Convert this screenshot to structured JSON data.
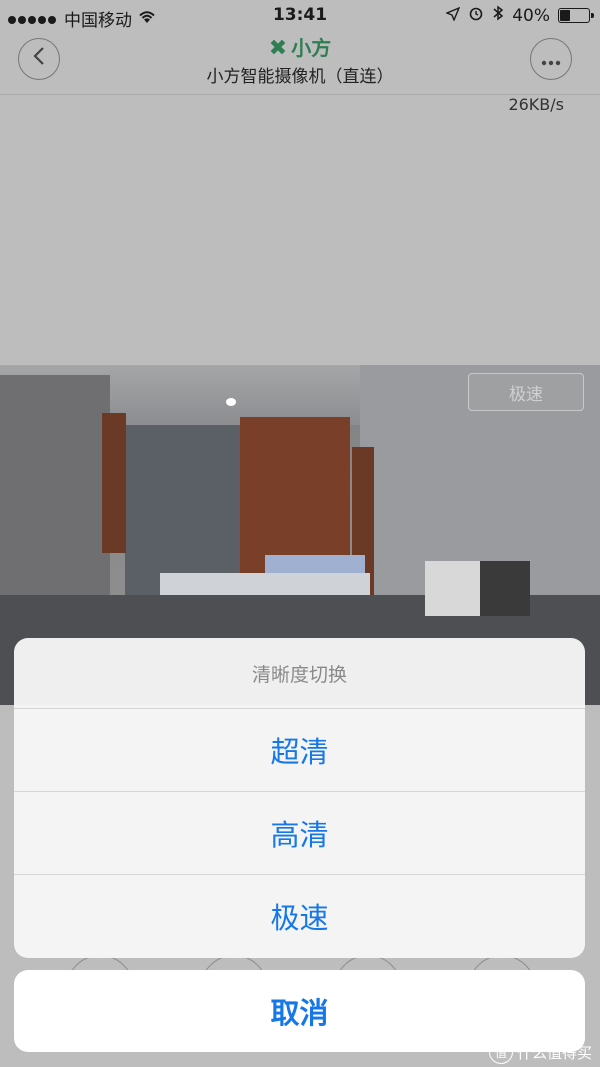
{
  "status_bar": {
    "carrier": "中国移动",
    "time": "13:41",
    "battery_percent": "40%",
    "battery_level": 0.4
  },
  "header": {
    "brand": "小方",
    "title": "小方智能摄像机（直连）",
    "back_icon": "chevron-left-icon",
    "more_icon": "ellipsis-icon"
  },
  "stream": {
    "speed": "26KB/s",
    "quality_label": "极速"
  },
  "action_sheet": {
    "title": "清晰度切换",
    "options": [
      "超清",
      "高清",
      "极速"
    ],
    "cancel_label": "取消"
  },
  "watermark": {
    "text": "什么值得买"
  },
  "colors": {
    "accent": "#1677e8",
    "brand_green": "#2f7d53",
    "backdrop": "#bdbdbd"
  }
}
